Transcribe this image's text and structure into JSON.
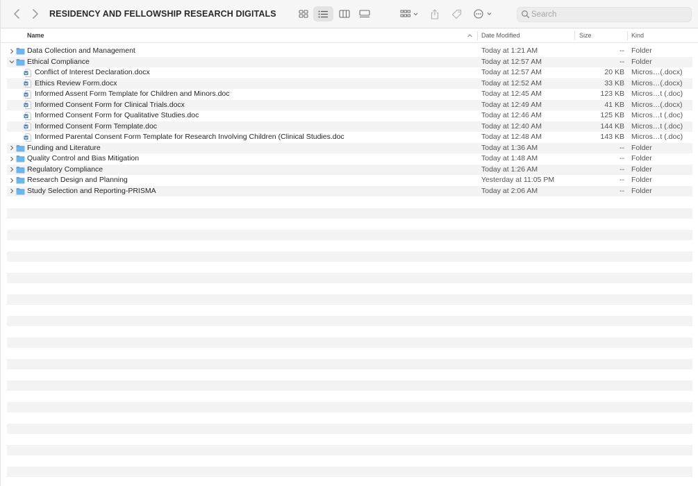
{
  "window": {
    "title": "RESIDENCY AND FELLOWSHIP RESEARCH DIGITALS"
  },
  "toolbar": {
    "icons": [
      "back-icon",
      "forward-icon",
      "icon-view-icon",
      "list-view-icon",
      "column-view-icon",
      "gallery-view-icon",
      "group-icon",
      "share-icon",
      "tag-icon",
      "more-actions-icon"
    ],
    "selected_view": "list"
  },
  "search": {
    "placeholder": "Search",
    "value": ""
  },
  "columns": {
    "name": "Name",
    "date": "Date Modified",
    "size": "Size",
    "kind": "Kind"
  },
  "colors": {
    "folder": "#5aa6e0",
    "stripe": "#f3f3f3",
    "doc_icon": "#2f6fbf"
  },
  "rows": [
    {
      "name": "Data Collection and Management",
      "date": "Today at 1:21 AM",
      "size": "--",
      "kind": "Folder",
      "type": "folder",
      "expanded": false,
      "level": 0
    },
    {
      "name": "Ethical Compliance",
      "date": "Today at 12:57 AM",
      "size": "--",
      "kind": "Folder",
      "type": "folder",
      "expanded": true,
      "level": 0
    },
    {
      "name": "Conflict of Interest Declaration.docx",
      "date": "Today at 12:57 AM",
      "size": "20 KB",
      "kind": "Micros…(.docx)",
      "type": "doc",
      "level": 1
    },
    {
      "name": "Ethics Review Form.docx",
      "date": "Today at 12:52 AM",
      "size": "33 KB",
      "kind": "Micros…(.docx)",
      "type": "doc",
      "level": 1
    },
    {
      "name": "Informed Assent Form Template for Children and Minors.doc",
      "date": "Today at 12:45 AM",
      "size": "123 KB",
      "kind": "Micros…t (.doc)",
      "type": "doc",
      "level": 1
    },
    {
      "name": "Informed Consent Form for Clinical Trials.docx",
      "date": "Today at 12:49 AM",
      "size": "41 KB",
      "kind": "Micros…(.docx)",
      "type": "doc",
      "level": 1
    },
    {
      "name": "Informed Consent Form for Qualitative Studies.doc",
      "date": "Today at 12:46 AM",
      "size": "125 KB",
      "kind": "Micros…t (.doc)",
      "type": "doc",
      "level": 1
    },
    {
      "name": "Informed Consent Form Template.doc",
      "date": "Today at 12:40 AM",
      "size": "144 KB",
      "kind": "Micros…t (.doc)",
      "type": "doc",
      "level": 1
    },
    {
      "name": "Informed Parental Consent Form Template for Research Involving Children (Clinical Studies.doc",
      "date": "Today at 12:48 AM",
      "size": "143 KB",
      "kind": "Micros…t (.doc)",
      "type": "doc",
      "level": 1
    },
    {
      "name": "Funding and Literature",
      "date": "Today at 1:36 AM",
      "size": "--",
      "kind": "Folder",
      "type": "folder",
      "expanded": false,
      "level": 0
    },
    {
      "name": "Quality Control and Bias Mitigation",
      "date": "Today at 1:48 AM",
      "size": "--",
      "kind": "Folder",
      "type": "folder",
      "expanded": false,
      "level": 0
    },
    {
      "name": "Regulatory Compliance",
      "date": "Today at 1:26 AM",
      "size": "--",
      "kind": "Folder",
      "type": "folder",
      "expanded": false,
      "level": 0
    },
    {
      "name": "Research Design and Planning",
      "date": "Yesterday at 11:05 PM",
      "size": "--",
      "kind": "Folder",
      "type": "folder",
      "expanded": false,
      "level": 0
    },
    {
      "name": "Study Selection and Reporting-PRISMA",
      "date": "Today at 2:06 AM",
      "size": "--",
      "kind": "Folder",
      "type": "folder",
      "expanded": false,
      "level": 0
    }
  ]
}
